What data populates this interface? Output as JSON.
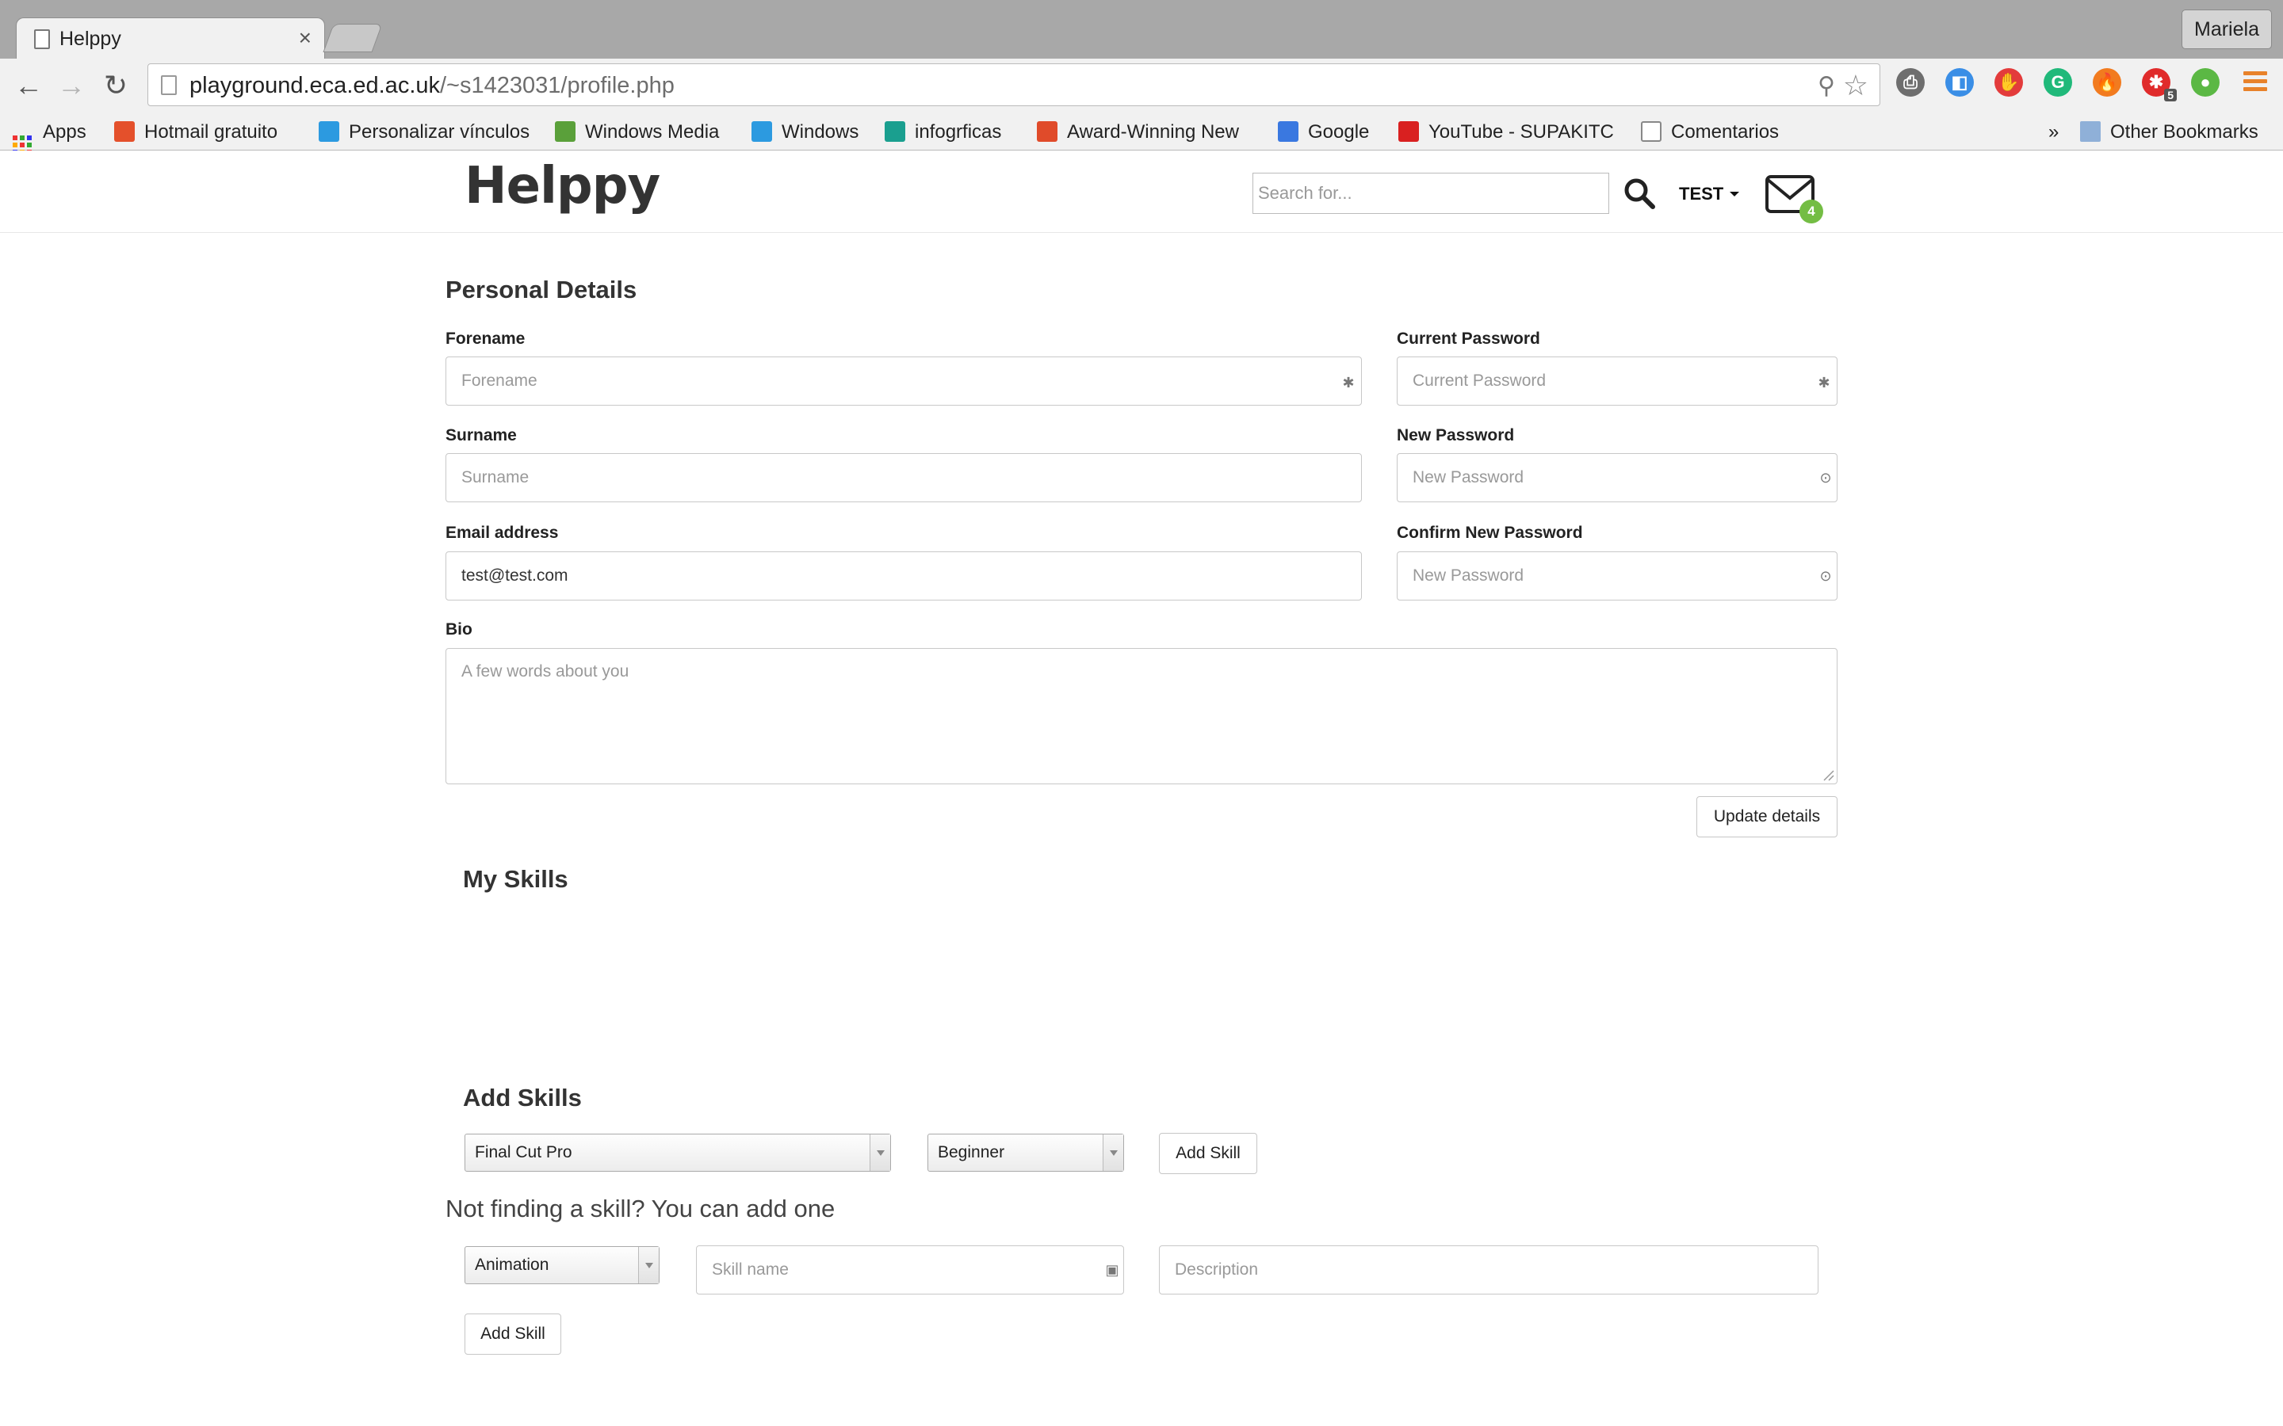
{
  "browser": {
    "tab_title": "Helppy",
    "tab_close": "×",
    "profile_name": "Mariela",
    "url_host": "playground.eca.ed.ac.uk",
    "url_path": "/~s1423031/profile.php",
    "back_glyph": "←",
    "forward_glyph": "→",
    "reload_glyph": "↻",
    "zoom_glyph": "⚲",
    "star_glyph": "☆",
    "extensions": [
      {
        "icon": "printer-extension-icon",
        "color": "#6e6e6e",
        "glyph": "⎙"
      },
      {
        "icon": "delicious-extension-icon",
        "color": "#3a8ee6",
        "glyph": "◧"
      },
      {
        "icon": "adblock-extension-icon",
        "color": "#e33b3b",
        "glyph": "✋"
      },
      {
        "icon": "grammarly-extension-icon",
        "color": "#20b97a",
        "glyph": "G"
      },
      {
        "icon": "flame-extension-icon",
        "color": "#f27b1f",
        "glyph": "🔥"
      },
      {
        "icon": "red-asterisk-extension-icon",
        "color": "#e02b2b",
        "glyph": "✱",
        "badge": "5"
      },
      {
        "icon": "evernote-extension-icon",
        "color": "#5bb844",
        "glyph": "●"
      }
    ],
    "bookmarks": [
      {
        "label": "Apps",
        "icon": "apps-grid-icon"
      },
      {
        "label": "Hotmail gratuito",
        "icon": "windows-logo-icon",
        "color": "#e4502b"
      },
      {
        "label": "Personalizar vínculos",
        "icon": "windows-flag-icon",
        "color": "#2c9ae0"
      },
      {
        "label": "Windows Media",
        "icon": "windows-xp-flag-icon",
        "color": "#5aa03a"
      },
      {
        "label": "Windows",
        "icon": "windows-flag-icon",
        "color": "#2c9ae0"
      },
      {
        "label": "infogrficas",
        "icon": "fm-icon",
        "color": "#1a9f8f"
      },
      {
        "label": "Award-Winning New",
        "icon": "scribd-icon",
        "color": "#e04b2a"
      },
      {
        "label": "Google",
        "icon": "google-icon",
        "color": "#3a78e0"
      },
      {
        "label": "YouTube - SUPAKITC",
        "icon": "youtube-icon",
        "color": "#d92020"
      },
      {
        "label": "Comentarios",
        "icon": "page-icon",
        "color": "#ffffff"
      }
    ],
    "overflow_chevron": "»",
    "other_bookmarks": "Other Bookmarks"
  },
  "header": {
    "logo": "Helppy",
    "search_placeholder": "Search for...",
    "user_label": "TEST",
    "mail_count": "4"
  },
  "personal": {
    "title": "Personal Details",
    "forename_label": "Forename",
    "forename_placeholder": "Forename",
    "surname_label": "Surname",
    "surname_placeholder": "Surname",
    "email_label": "Email address",
    "email_value": "test@test.com",
    "current_password_label": "Current Password",
    "current_password_placeholder": "Current Password",
    "new_password_label": "New Password",
    "new_password_placeholder": "New Password",
    "confirm_password_label": "Confirm New Password",
    "confirm_password_placeholder": "New Password",
    "bio_label": "Bio",
    "bio_placeholder": "A few words about you",
    "update_button": "Update details"
  },
  "my_skills": {
    "title": "My Skills"
  },
  "add_skills": {
    "title": "Add Skills",
    "skill_selected": "Final Cut Pro",
    "level_selected": "Beginner",
    "add_button": "Add Skill",
    "hint": "Not finding a skill? You can add one",
    "category_selected": "Animation",
    "skill_name_placeholder": "Skill name",
    "description_placeholder": "Description",
    "add_new_button": "Add Skill"
  },
  "colors": {
    "badge_green": "#74bd44",
    "tabstrip_gray": "#a8a8a8"
  }
}
